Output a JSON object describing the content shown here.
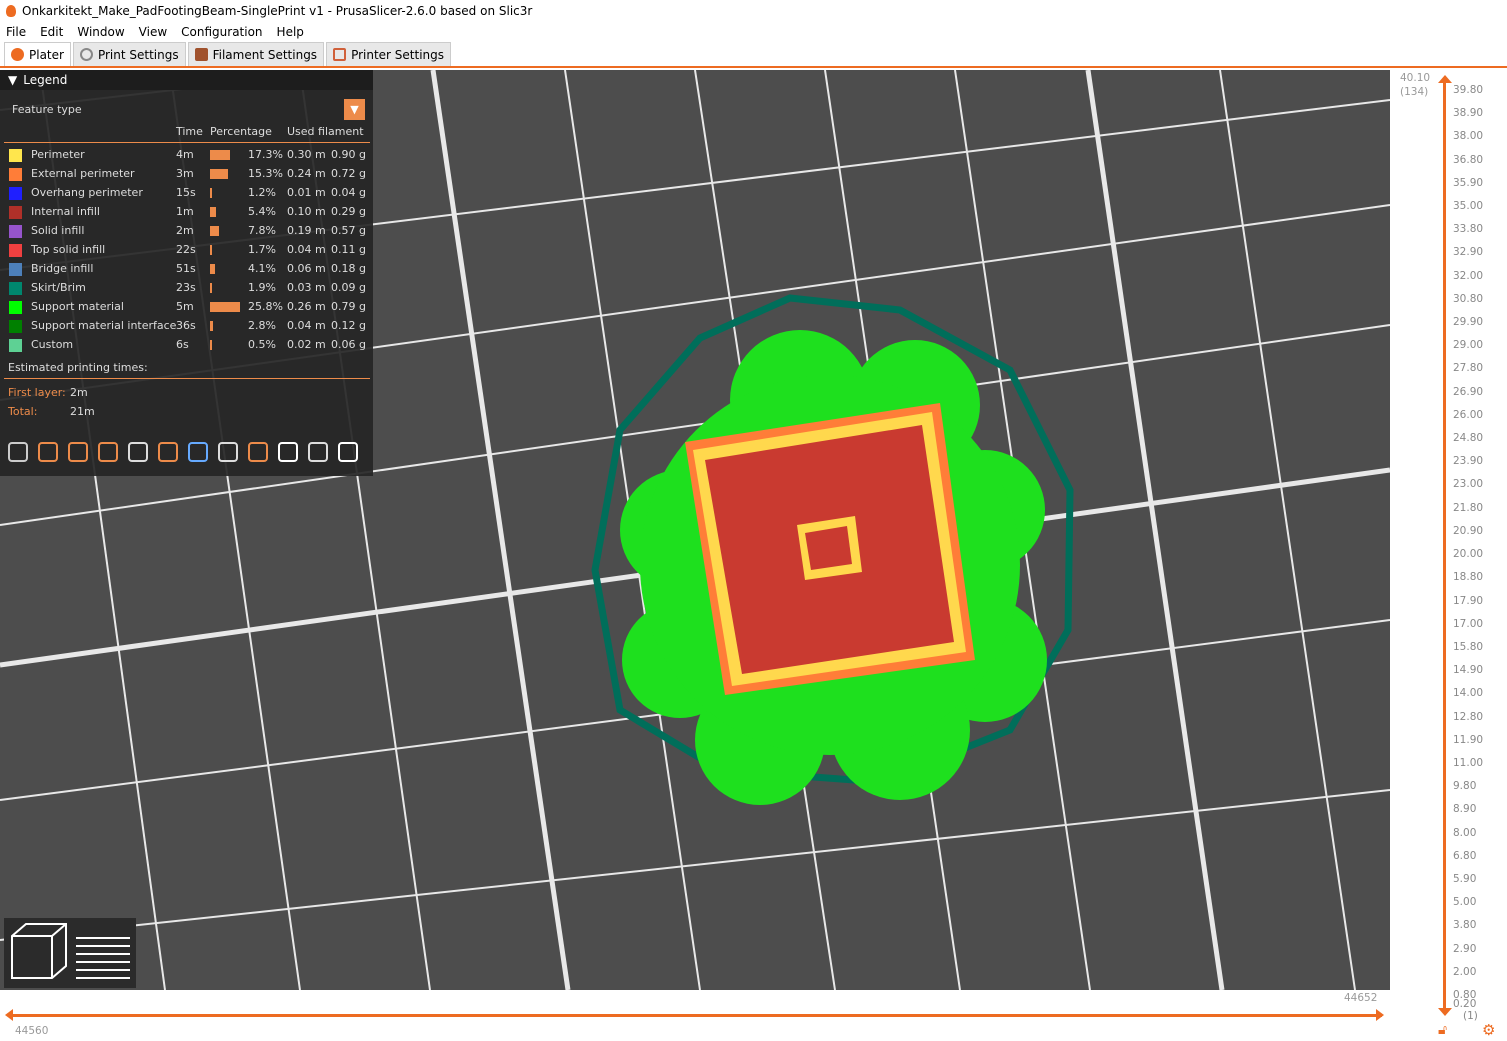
{
  "window": {
    "title": "Onkarkitekt_Make_PadFootingBeam-SinglePrint v1 - PrusaSlicer-2.6.0 based on Slic3r"
  },
  "menu": [
    "File",
    "Edit",
    "Window",
    "View",
    "Configuration",
    "Help"
  ],
  "tabs": [
    {
      "label": "Plater",
      "color": "#ed6b21"
    },
    {
      "label": "Print Settings",
      "color": "#888888"
    },
    {
      "label": "Filament Settings",
      "color": "#a0522d"
    },
    {
      "label": "Printer Settings",
      "color": "#d0603a"
    }
  ],
  "legend": {
    "title": "Legend",
    "view_type": "Feature type",
    "columns": {
      "time": "Time",
      "percentage": "Percentage",
      "used_filament": "Used filament"
    },
    "items": [
      {
        "label": "Perimeter",
        "color": "#ffe64d",
        "time": "4m",
        "percent": "17.3%",
        "pct": 17.3,
        "length": "0.30 m",
        "weight": "0.90 g"
      },
      {
        "label": "External perimeter",
        "color": "#ff7d38",
        "time": "3m",
        "percent": "15.3%",
        "pct": 15.3,
        "length": "0.24 m",
        "weight": "0.72 g"
      },
      {
        "label": "Overhang perimeter",
        "color": "#1f1fff",
        "time": "15s",
        "percent": "1.2%",
        "pct": 1.2,
        "length": "0.01 m",
        "weight": "0.04 g"
      },
      {
        "label": "Internal infill",
        "color": "#b03029",
        "time": "1m",
        "percent": "5.4%",
        "pct": 5.4,
        "length": "0.10 m",
        "weight": "0.29 g"
      },
      {
        "label": "Solid infill",
        "color": "#9654cc",
        "time": "2m",
        "percent": "7.8%",
        "pct": 7.8,
        "length": "0.19 m",
        "weight": "0.57 g"
      },
      {
        "label": "Top solid infill",
        "color": "#f04040",
        "time": "22s",
        "percent": "1.7%",
        "pct": 1.7,
        "length": "0.04 m",
        "weight": "0.11 g"
      },
      {
        "label": "Bridge infill",
        "color": "#4d80ba",
        "time": "51s",
        "percent": "4.1%",
        "pct": 4.1,
        "length": "0.06 m",
        "weight": "0.18 g"
      },
      {
        "label": "Skirt/Brim",
        "color": "#00876e",
        "time": "23s",
        "percent": "1.9%",
        "pct": 1.9,
        "length": "0.03 m",
        "weight": "0.09 g"
      },
      {
        "label": "Support material",
        "color": "#00ff00",
        "time": "5m",
        "percent": "25.8%",
        "pct": 25.8,
        "length": "0.26 m",
        "weight": "0.79 g"
      },
      {
        "label": "Support material interface",
        "color": "#008000",
        "time": "36s",
        "percent": "2.8%",
        "pct": 2.8,
        "length": "0.04 m",
        "weight": "0.12 g"
      },
      {
        "label": "Custom",
        "color": "#5ed194",
        "time": "6s",
        "percent": "0.5%",
        "pct": 0.5,
        "length": "0.02 m",
        "weight": "0.06 g"
      }
    ],
    "estimated_label": "Estimated printing times:",
    "first_layer_label": "First layer:",
    "first_layer": "2m",
    "total_label": "Total:",
    "total": "21m"
  },
  "vslider": {
    "top_value": "40.10",
    "top_layer": "(134)",
    "bottom_value": "0.20",
    "bottom_layer": "(1)",
    "ticks": [
      "39.80",
      "38.90",
      "38.00",
      "36.80",
      "35.90",
      "35.00",
      "33.80",
      "32.90",
      "32.00",
      "30.80",
      "29.90",
      "29.00",
      "27.80",
      "26.90",
      "26.00",
      "24.80",
      "23.90",
      "23.00",
      "21.80",
      "20.90",
      "20.00",
      "18.80",
      "17.90",
      "17.00",
      "15.80",
      "14.90",
      "14.00",
      "12.80",
      "11.90",
      "11.00",
      "9.80",
      "8.90",
      "8.00",
      "6.80",
      "5.90",
      "5.00",
      "3.80",
      "2.90",
      "2.00",
      "0.80"
    ]
  },
  "hslider": {
    "left_value": "44560",
    "right_value": "44652"
  },
  "colors": {
    "accent": "#ed6b21",
    "bed": "#4d4d4d"
  }
}
